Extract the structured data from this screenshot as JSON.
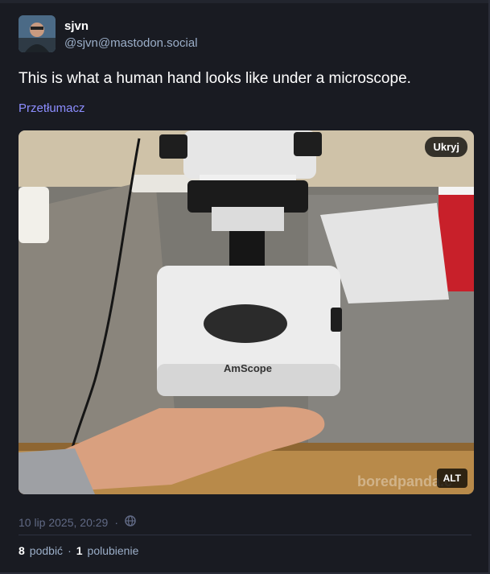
{
  "account": {
    "display_name": "sjvn",
    "handle": "@sjvn@mastodon.social",
    "avatar_icon": "user-avatar"
  },
  "status": {
    "text": "This is what a human hand looks like under a microscope.",
    "translate_label": "Przetłumacz",
    "timestamp": "10 lip 2025, 20:29",
    "separator": "·",
    "visibility_icon": "globe-icon"
  },
  "media": {
    "hide_label": "Ukryj",
    "alt_label": "ALT",
    "brand_text": "AmScope",
    "watermark_text": "boredpanda.c"
  },
  "stats": {
    "boosts_count": "8",
    "boosts_label": "podbić",
    "favs_count": "1",
    "favs_label": "polubienie",
    "separator": "·"
  },
  "colors": {
    "background": "#191b22",
    "link": "#8c8dff",
    "muted": "#606984",
    "secondary": "#9baec8"
  }
}
